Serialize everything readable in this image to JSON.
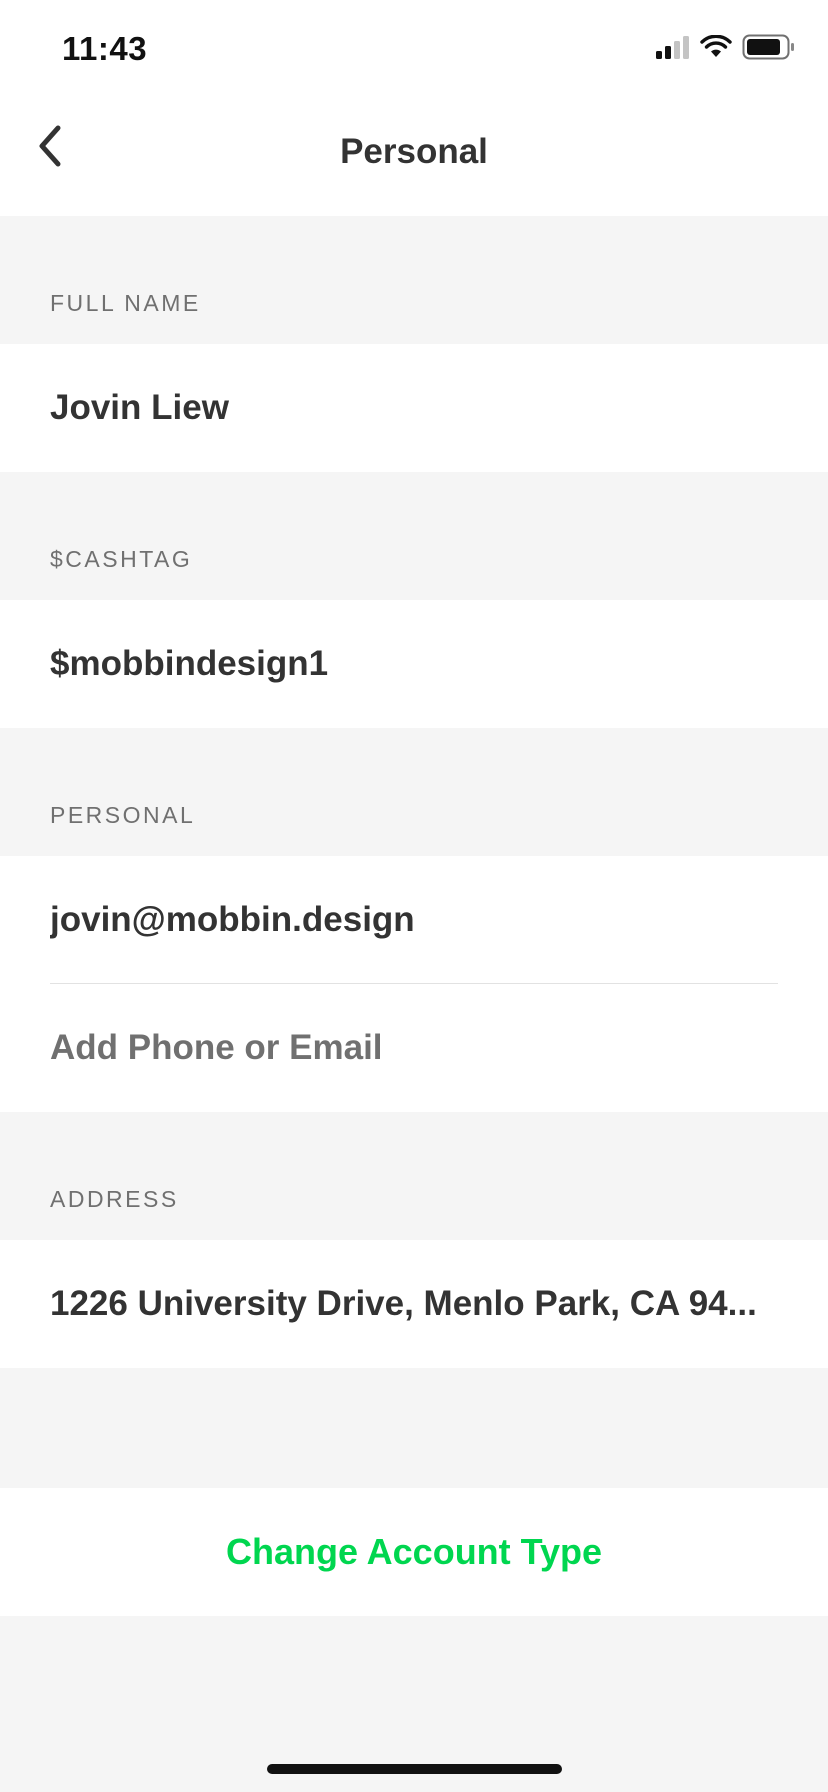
{
  "status_bar": {
    "time": "11:43"
  },
  "nav": {
    "title": "Personal",
    "back_icon": "chevron-left-icon"
  },
  "sections": {
    "full_name": {
      "header": "FULL NAME",
      "value": "Jovin Liew"
    },
    "cashtag": {
      "header": "$CASHTAG",
      "value": "$mobbindesign1"
    },
    "personal": {
      "header": "PERSONAL",
      "email": "jovin@mobbin.design",
      "add_label": "Add Phone or Email"
    },
    "address": {
      "header": "ADDRESS",
      "value": "1226 University Drive, Menlo Park, CA 94..."
    }
  },
  "actions": {
    "change_account_type": "Change Account Type"
  },
  "colors": {
    "accent": "#00d64f",
    "background": "#f5f5f5",
    "text": "#333333",
    "muted": "#707070"
  }
}
